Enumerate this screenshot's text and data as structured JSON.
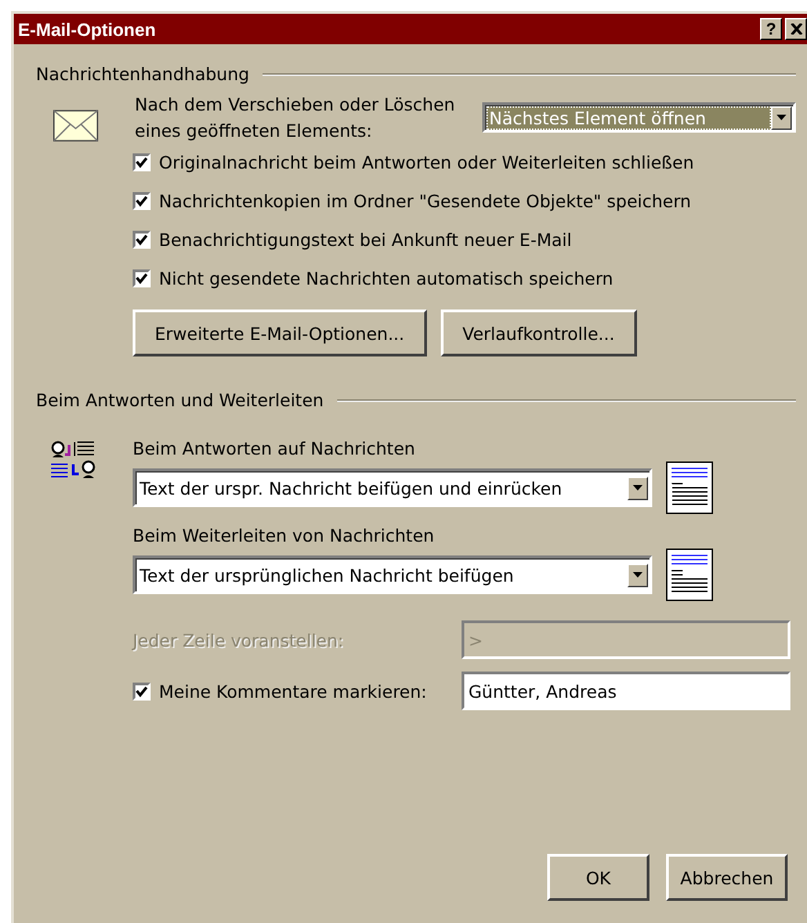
{
  "window": {
    "title": "E-Mail-Optionen",
    "help_button": "?"
  },
  "message_handling": {
    "title": "Nachrichtenhandhabung",
    "after_move_label": "Nach dem Verschieben oder Löschen eines geöffneten Elements:",
    "after_move_dropdown": {
      "value": "Nächstes Element öffnen",
      "focused": true
    },
    "options": [
      {
        "label": "Originalnachricht beim Antworten oder Weiterleiten schließen",
        "checked": true
      },
      {
        "label": "Nachrichtenkopien im Ordner \"Gesendete Objekte\" speichern",
        "checked": true
      },
      {
        "label": "Benachrichtigungstext bei Ankunft neuer E-Mail",
        "checked": true
      },
      {
        "label": "Nicht gesendete Nachrichten automatisch speichern",
        "checked": true
      }
    ],
    "buttons": [
      "Erweiterte E-Mail-Optionen...",
      "Verlaufkontrolle..."
    ]
  },
  "reply_forward": {
    "title": "Beim Antworten und Weiterleiten",
    "dropdowns": [
      {
        "label": "Beim Antworten auf Nachrichten",
        "value": "Text der urspr. Nachricht beifügen und einrücken",
        "kind": "indented"
      },
      {
        "label": "Beim Weiterleiten von Nachrichten",
        "value": "Text der ursprünglichen Nachricht beifügen",
        "kind": "plain"
      }
    ],
    "prefix": {
      "label": "Jeder Zeile voranstellen:",
      "value": ">",
      "disabled": true
    },
    "mark_comments": {
      "label": "Meine Kommentare markieren:",
      "checked": true,
      "value": "Güntter, Andreas"
    }
  },
  "buttons": [
    "OK",
    "Abbrechen"
  ]
}
